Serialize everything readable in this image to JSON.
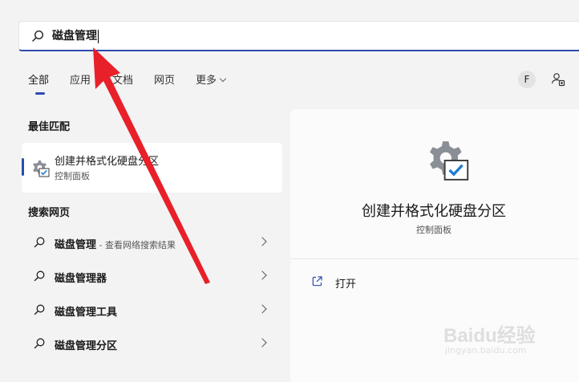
{
  "search": {
    "query": "磁盘管理"
  },
  "tabs": [
    {
      "label": "全部",
      "active": true
    },
    {
      "label": "应用"
    },
    {
      "label": "文档"
    },
    {
      "label": "网页"
    },
    {
      "label": "更多"
    }
  ],
  "header_right": {
    "avatar_letter": "F",
    "share_icon": "people-share-icon"
  },
  "best_match": {
    "section_title": "最佳匹配",
    "title": "创建并格式化硬盘分区",
    "subtitle": "控制面板",
    "icon": "gear-checkbox-icon"
  },
  "web_search": {
    "section_title": "搜索网页",
    "items": [
      {
        "text": "磁盘管理",
        "suffix": " - 查看网络搜索结果"
      },
      {
        "text": "磁盘管理器",
        "suffix": ""
      },
      {
        "text": "磁盘管理工具",
        "suffix": ""
      },
      {
        "text": "磁盘管理分区",
        "suffix": ""
      }
    ]
  },
  "detail": {
    "title": "创建并格式化硬盘分区",
    "subtitle": "控制面板",
    "actions": [
      {
        "label": "打开",
        "icon": "open-external-icon"
      }
    ]
  },
  "watermark": {
    "logo": "Baidu经验",
    "url": "jingyan.baidu.com"
  },
  "colors": {
    "accent": "#2c4bb0",
    "arrow": "#e8202a",
    "background": "#f3f3f3"
  }
}
